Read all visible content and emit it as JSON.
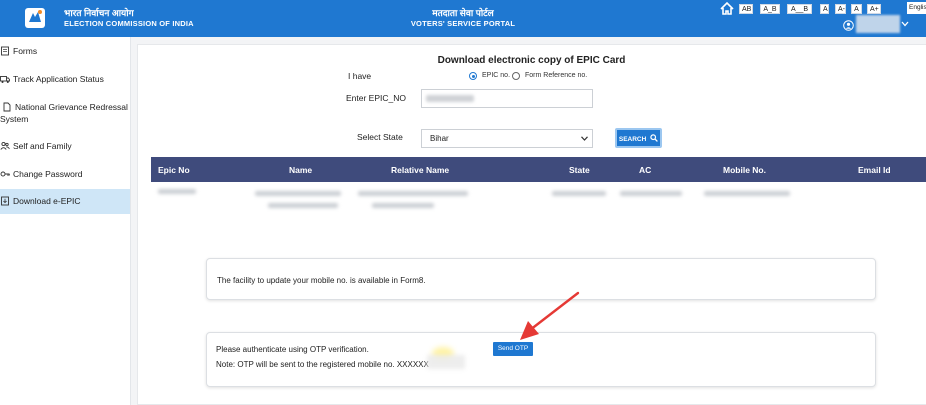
{
  "header": {
    "org_hindi": "भारत निर्वाचन आयोग",
    "org_english": "ELECTION COMMISSION OF INDIA",
    "portal_hindi": "मतदाता सेवा पोर्टल",
    "portal_english": "VOTERS' SERVICE PORTAL",
    "accessibility": [
      "AB",
      "A_B",
      "A__B",
      "A",
      "A-",
      "A",
      "A+"
    ],
    "language": "English",
    "home_icon": "home-icon",
    "user_icon": "user-circle-icon",
    "brand_color": "#1f78d1"
  },
  "sidebar": {
    "items": [
      {
        "label": "Forms",
        "icon": "form-icon"
      },
      {
        "label": "Track Application Status",
        "icon": "truck-icon"
      },
      {
        "label": "National Grievance Redressal",
        "label2": "System",
        "icon": "document-icon"
      },
      {
        "label": "Self and Family",
        "icon": "users-icon"
      },
      {
        "label": "Change Password",
        "icon": "key-icon"
      },
      {
        "label": "Download e-EPIC",
        "icon": "download-document-icon",
        "active": true
      }
    ]
  },
  "form": {
    "title": "Download electronic copy of EPIC Card",
    "i_have_label": "I have",
    "radio_epic": "EPIC no.",
    "radio_reference": "Form Reference no.",
    "epic_label": "Enter EPIC_NO",
    "state_label": "Select State",
    "state_value": "Bihar",
    "search_label": "SEARCH"
  },
  "table": {
    "headers": [
      "Epic No",
      "Name",
      "Relative Name",
      "State",
      "AC",
      "Mobile No.",
      "Email Id"
    ],
    "header_color": "#3f4b7c"
  },
  "notices": {
    "mobile_update": "The facility to update your mobile no. is available in Form8.",
    "otp_auth": "Please authenticate using OTP verification.",
    "otp_note": "Note: OTP will be sent to the registered mobile no. XXXXXX",
    "send_otp_label": "Send OTP"
  },
  "annotation_color": "#e53935"
}
